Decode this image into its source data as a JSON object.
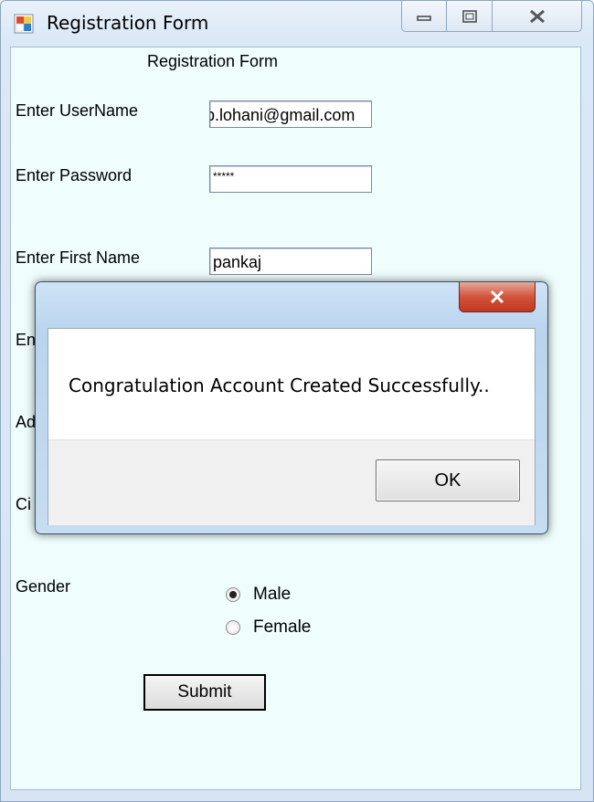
{
  "window": {
    "title": "Registration Form"
  },
  "form": {
    "heading": "Registration Form",
    "username_label": "Enter UserName",
    "username_value": "p.lohani@gmail.com",
    "password_label": "Enter Password",
    "password_value": "*****",
    "first_name_label": "Enter First Name",
    "first_name_value": "pankaj",
    "last_name_label_partial": "En",
    "address_label_partial": "Ad",
    "city_label_partial": "Ci",
    "gender_label": "Gender",
    "gender_options": [
      {
        "label": "Male",
        "selected": true
      },
      {
        "label": "Female",
        "selected": false
      }
    ],
    "submit_label": "Submit"
  },
  "dialog": {
    "message": "Congratulation Account Created Successfully..",
    "ok_label": "OK"
  },
  "colors": {
    "client_background": "#effdfd",
    "dialog_close": "#c3381f"
  }
}
